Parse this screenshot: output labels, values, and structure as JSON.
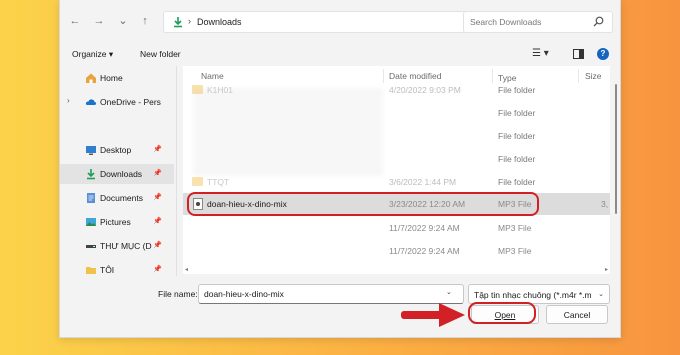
{
  "address_bar": {
    "back": "←",
    "forward": "→",
    "recent": "⌄",
    "up": "↑",
    "separator": "›",
    "path": "Downloads",
    "dropdown": "⌄",
    "refresh": "↻",
    "search_placeholder": "Search Downloads"
  },
  "toolbar": {
    "organize": "Organize ▾",
    "new_folder": "New folder",
    "view": "☰ ▾",
    "help": "?"
  },
  "sidebar": {
    "items": [
      {
        "label": "Home",
        "icon": "home-icon"
      },
      {
        "label": "OneDrive - Pers",
        "icon": "cloud-icon",
        "expander": "›"
      },
      {
        "label": "Desktop",
        "icon": "desktop-icon",
        "pin": "📌"
      },
      {
        "label": "Downloads",
        "icon": "download-icon",
        "pin": "📌"
      },
      {
        "label": "Documents",
        "icon": "document-icon",
        "pin": "📌"
      },
      {
        "label": "Pictures",
        "icon": "pictures-icon",
        "pin": "📌"
      },
      {
        "label": "THƯ MỤC (D",
        "icon": "drive-icon",
        "pin": "📌"
      },
      {
        "label": "TÔI",
        "icon": "folder-icon",
        "pin": "📌"
      }
    ]
  },
  "columns": {
    "name": "Name",
    "date": "Date modified",
    "type": "Type",
    "size": "Size",
    "sort_arrow": "^"
  },
  "files": [
    {
      "name": "K1H01",
      "date": "4/20/2022 9:03 PM",
      "type": "File folder",
      "size": "",
      "kind": "folder",
      "ghost": true
    },
    {
      "name": "",
      "date": "",
      "type": "File folder",
      "size": "",
      "kind": "none"
    },
    {
      "name": "",
      "date": "",
      "type": "File folder",
      "size": "",
      "kind": "none"
    },
    {
      "name": "",
      "date": "",
      "type": "File folder",
      "size": "",
      "kind": "none"
    },
    {
      "name": "TTQT",
      "date": "3/6/2022 1:44 PM",
      "type": "File folder",
      "size": "",
      "kind": "folder",
      "ghost": true
    },
    {
      "name": "doan-hieu-x-dino-mix",
      "date": "3/23/2022 12:20 AM",
      "type": "MP3 File",
      "size": "3,",
      "kind": "mp3",
      "selected": true
    },
    {
      "name": "",
      "date": "11/7/2022 9:24 AM",
      "type": "MP3 File",
      "size": "",
      "kind": "none"
    },
    {
      "name": "",
      "date": "11/7/2022 9:24 AM",
      "type": "MP3 File",
      "size": "",
      "kind": "none"
    }
  ],
  "scroll": {
    "left": "◂",
    "right": "▸"
  },
  "footer": {
    "file_name_label": "File name:",
    "file_name_value": "doan-hieu-x-dino-mix",
    "file_name_dropdown": "⌄",
    "file_type": "Tập tin nhạc chuông (*.m4r *.m",
    "file_type_dropdown": "⌄",
    "open": "Open",
    "cancel": "Cancel"
  },
  "colors": {
    "highlight": "#d12026",
    "background_start": "#fbd34a",
    "background_end": "#f7943f",
    "folder": "#f0c24b",
    "accent": "#1565c0"
  }
}
